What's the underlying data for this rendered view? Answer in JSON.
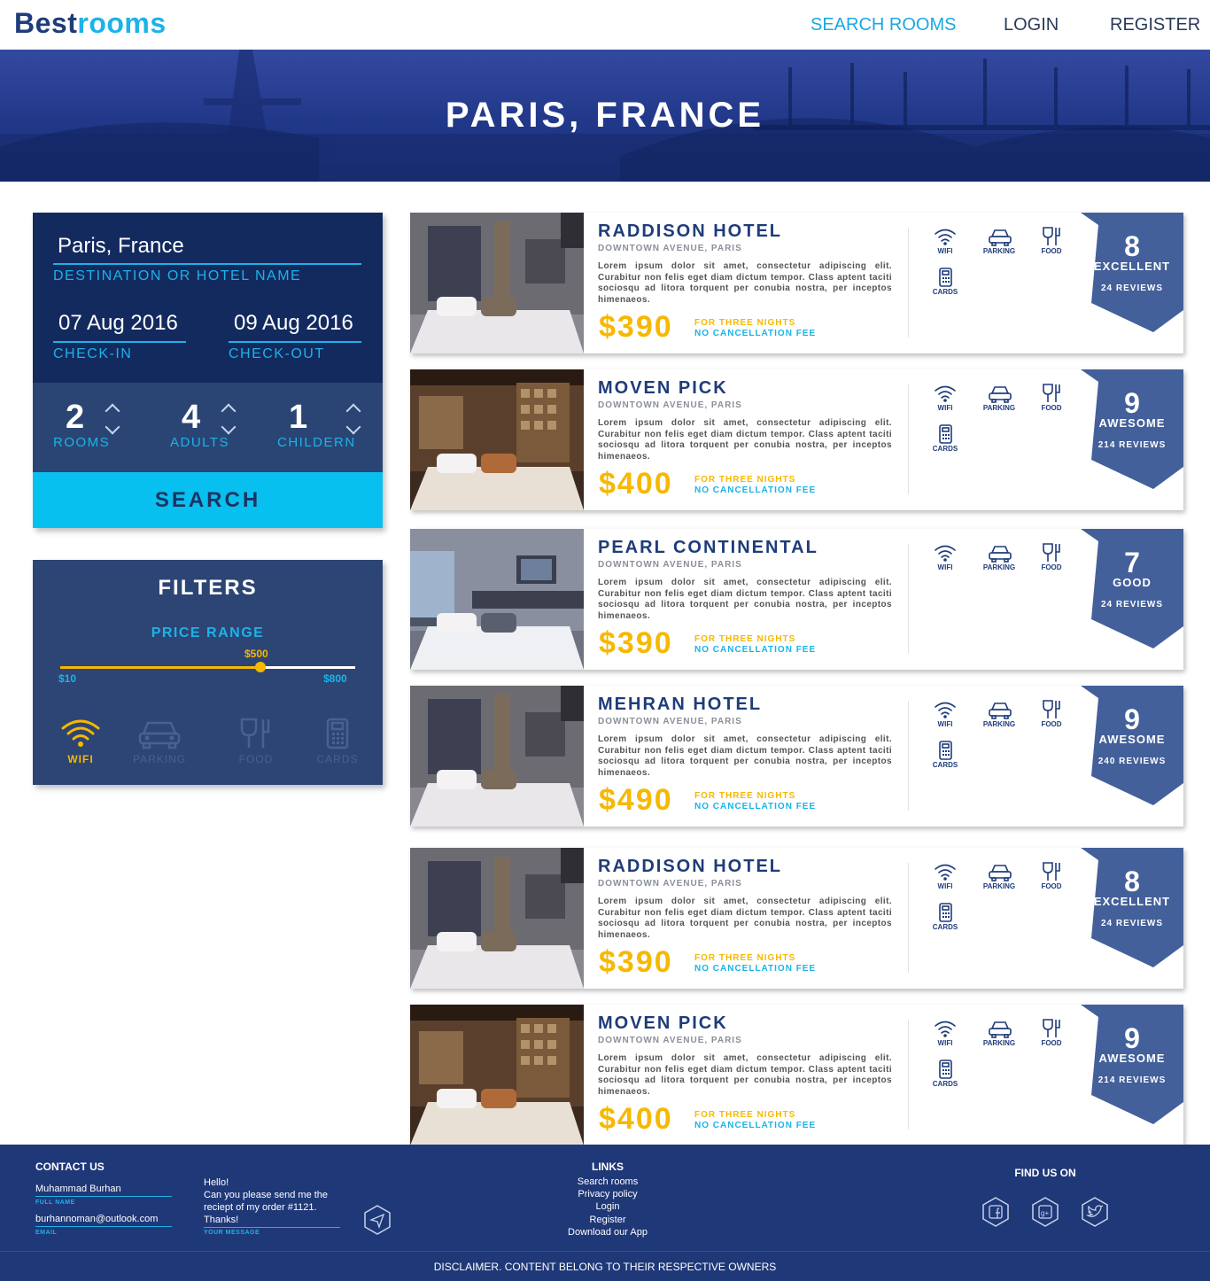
{
  "brand": {
    "part1": "Best",
    "part2": "rooms"
  },
  "nav": {
    "search": "SEARCH ROOMS",
    "login": "LOGIN",
    "register": "REGISTER"
  },
  "hero": {
    "title": "PARIS, FRANCE"
  },
  "search": {
    "destination_value": "Paris, France",
    "destination_label": "DESTINATION OR HOTEL NAME",
    "checkin_value": "07 Aug 2016",
    "checkin_label": "CHECK-IN",
    "checkout_value": "09 Aug 2016",
    "checkout_label": "CHECK-OUT",
    "rooms": "2",
    "rooms_label": "ROOMS",
    "adults": "4",
    "adults_label": "ADULTS",
    "children": "1",
    "children_label": "CHILDERN",
    "button": "SEARCH"
  },
  "filters": {
    "title": "FILTERS",
    "price_label": "PRICE RANGE",
    "price_value": "$500",
    "price_min": "$10",
    "price_max": "$800",
    "price_fraction": 0.68,
    "amenities": [
      {
        "label": "WIFI",
        "icon": "wifi-icon",
        "active": true
      },
      {
        "label": "PARKING",
        "icon": "car-icon",
        "active": false
      },
      {
        "label": "FOOD",
        "icon": "food-icon",
        "active": false
      },
      {
        "label": "CARDS",
        "icon": "card-icon",
        "active": false
      }
    ]
  },
  "hotels": [
    {
      "name": "RADDISON HOTEL",
      "address": "DOWNTOWN AVENUE, PARIS",
      "desc": "Lorem ipsum dolor sit amet, consectetur adipiscing elit. Curabitur non felis eget diam dictum tempor. Class aptent taciti sociosqu ad litora torquent per conubia nostra, per inceptos himenaeos.",
      "price": "$390",
      "nights": "FOR THREE NIGHTS",
      "fee": "NO CANCELLATION FEE",
      "score": "8",
      "rating": "EXCELLENT",
      "reviews": "24 REVIEWS",
      "amenities": [
        "WIFI",
        "PARKING",
        "FOOD",
        "CARDS"
      ]
    },
    {
      "name": "MOVEN PICK",
      "address": "DOWNTOWN AVENUE, PARIS",
      "desc": "Lorem ipsum dolor sit amet, consectetur adipiscing elit. Curabitur non felis eget diam dictum tempor. Class aptent taciti sociosqu ad litora torquent per conubia nostra, per inceptos himenaeos.",
      "price": "$400",
      "nights": "FOR THREE NIGHTS",
      "fee": "NO CANCELLATION FEE",
      "score": "9",
      "rating": "AWESOME",
      "reviews": "214 REVIEWS",
      "amenities": [
        "WIFI",
        "PARKING",
        "FOOD",
        "CARDS"
      ]
    },
    {
      "name": "PEARL CONTINENTAL",
      "address": "DOWNTOWN AVENUE, PARIS",
      "desc": "Lorem ipsum dolor sit amet, consectetur adipiscing elit. Curabitur non felis eget diam dictum tempor. Class aptent taciti sociosqu ad litora torquent per conubia nostra, per inceptos himenaeos.",
      "price": "$390",
      "nights": "FOR THREE NIGHTS",
      "fee": "NO CANCELLATION FEE",
      "score": "7",
      "rating": "GOOD",
      "reviews": "24 REVIEWS",
      "amenities": [
        "WIFI",
        "PARKING",
        "FOOD"
      ]
    },
    {
      "name": "MEHRAN HOTEL",
      "address": "DOWNTOWN AVENUE, PARIS",
      "desc": "Lorem ipsum dolor sit amet, consectetur adipiscing elit. Curabitur non felis eget diam dictum tempor. Class aptent taciti sociosqu ad litora torquent per conubia nostra, per inceptos himenaeos.",
      "price": "$490",
      "nights": "FOR THREE NIGHTS",
      "fee": "NO CANCELLATION FEE",
      "score": "9",
      "rating": "AWESOME",
      "reviews": "240 REVIEWS",
      "amenities": [
        "WIFI",
        "PARKING",
        "FOOD",
        "CARDS"
      ]
    },
    {
      "name": "RADDISON HOTEL",
      "address": "DOWNTOWN AVENUE, PARIS",
      "desc": "Lorem ipsum dolor sit amet, consectetur adipiscing elit. Curabitur non felis eget diam dictum tempor. Class aptent taciti sociosqu ad litora torquent per conubia nostra, per inceptos himenaeos.",
      "price": "$390",
      "nights": "FOR THREE NIGHTS",
      "fee": "NO CANCELLATION FEE",
      "score": "8",
      "rating": "EXCELLENT",
      "reviews": "24 REVIEWS",
      "amenities": [
        "WIFI",
        "PARKING",
        "FOOD",
        "CARDS"
      ]
    },
    {
      "name": "MOVEN PICK",
      "address": "DOWNTOWN AVENUE, PARIS",
      "desc": "Lorem ipsum dolor sit amet, consectetur adipiscing elit. Curabitur non felis eget diam dictum tempor. Class aptent taciti sociosqu ad litora torquent per conubia nostra, per inceptos himenaeos.",
      "price": "$400",
      "nights": "FOR THREE NIGHTS",
      "fee": "NO CANCELLATION FEE",
      "score": "9",
      "rating": "AWESOME",
      "reviews": "214 REVIEWS",
      "amenities": [
        "WIFI",
        "PARKING",
        "FOOD",
        "CARDS"
      ]
    }
  ],
  "footer": {
    "contact_title": "CONTACT US",
    "name_value": "Muhammad Burhan",
    "name_label": "FULL NAME",
    "email_value": "burhannoman@outlook.com",
    "email_label": "EMAIL",
    "message_lines": [
      "Hello!",
      "Can you please send me the",
      "reciept of my order #1121.",
      "Thanks!"
    ],
    "message_label": "YOUR MESSAGE",
    "links_title": "LINKS",
    "links": [
      "Search rooms",
      "Privacy policy",
      "Login",
      "Register",
      "Download our App"
    ],
    "find_title": "FIND US ON",
    "social": [
      "facebook-icon",
      "google-plus-icon",
      "twitter-icon"
    ],
    "disclaimer": "DISCLAIMER. CONTENT BELONG TO THEIR RESPECTIVE OWNERS"
  },
  "colors": {
    "navy": "#1f3c7a",
    "cyan": "#1bb3e8",
    "gold": "#f6b800",
    "panel": "#2c4574"
  }
}
